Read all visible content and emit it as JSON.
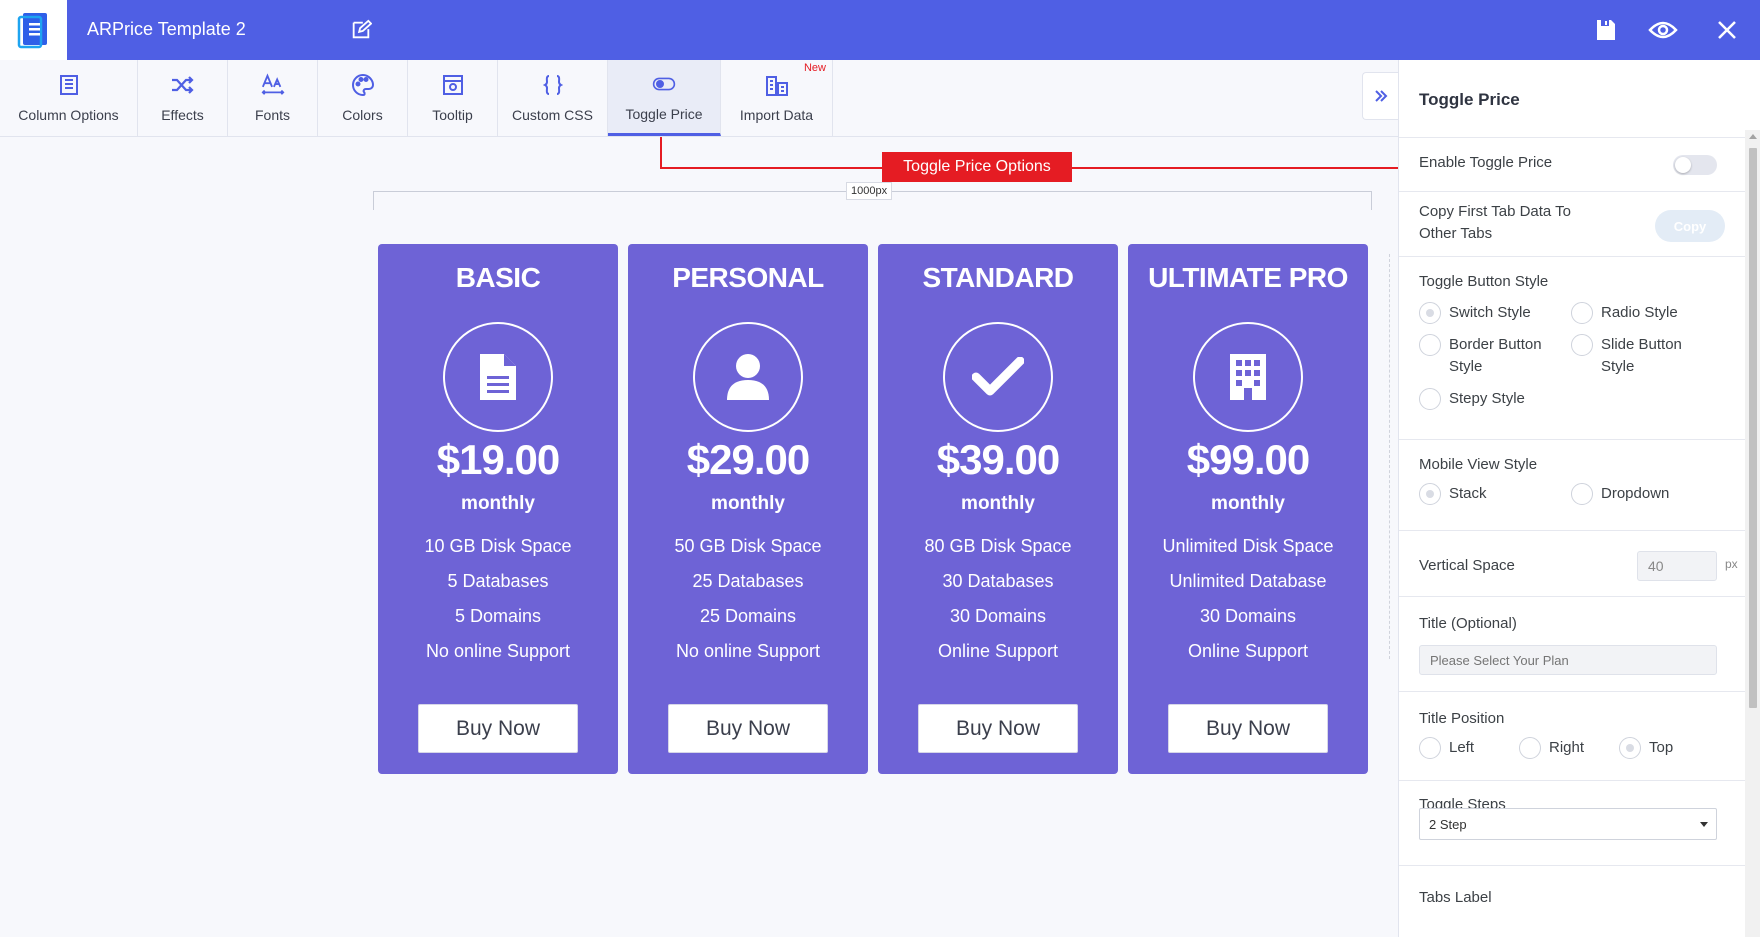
{
  "app": {
    "title": "ARPrice Template 2"
  },
  "toolbar": {
    "items": [
      {
        "label": "Column Options",
        "icon": "columns-icon"
      },
      {
        "label": "Effects",
        "icon": "shuffle-icon"
      },
      {
        "label": "Fonts",
        "icon": "font-size-icon"
      },
      {
        "label": "Colors",
        "icon": "palette-icon"
      },
      {
        "label": "Tooltip",
        "icon": "tooltip-icon"
      },
      {
        "label": "Custom CSS",
        "icon": "braces-icon"
      },
      {
        "label": "Toggle Price",
        "icon": "toggle-icon"
      },
      {
        "label": "Import Data",
        "icon": "import-icon"
      }
    ],
    "active": "Toggle Price",
    "new_badge": "New"
  },
  "canvas": {
    "callout": "Toggle Price Options",
    "ruler_label": "1000px"
  },
  "plans": [
    {
      "title": "BASIC",
      "icon": "file-icon",
      "price": "$19.00",
      "period": "monthly",
      "features": [
        "10 GB Disk Space",
        "5 Databases",
        "5 Domains",
        "No online Support"
      ],
      "button": "Buy Now"
    },
    {
      "title": "PERSONAL",
      "icon": "user-icon",
      "price": "$29.00",
      "period": "monthly",
      "features": [
        "50 GB Disk Space",
        "25 Databases",
        "25 Domains",
        "No online Support"
      ],
      "button": "Buy Now"
    },
    {
      "title": "STANDARD",
      "icon": "check-icon",
      "price": "$39.00",
      "period": "monthly",
      "features": [
        "80 GB Disk Space",
        "30 Databases",
        "30 Domains",
        "Online Support"
      ],
      "button": "Buy Now"
    },
    {
      "title": "ULTIMATE PRO",
      "icon": "building-icon",
      "price": "$99.00",
      "period": "monthly",
      "features": [
        "Unlimited Disk Space",
        "Unlimited Database",
        "30 Domains",
        "Online Support"
      ],
      "button": "Buy Now"
    }
  ],
  "panel": {
    "title": "Toggle Price",
    "enable_toggle": {
      "label": "Enable Toggle Price",
      "on": false
    },
    "copy_tab": {
      "label_line1": "Copy First Tab Data To",
      "label_line2": "Other Tabs",
      "button": "Copy"
    },
    "button_style": {
      "label": "Toggle Button Style",
      "options": [
        {
          "line1": "Switch Style",
          "line2": "",
          "selected": true
        },
        {
          "line1": "Radio Style",
          "line2": "",
          "selected": false
        },
        {
          "line1": "Border Button",
          "line2": "Style",
          "selected": false
        },
        {
          "line1": "Slide Button",
          "line2": "Style",
          "selected": false
        },
        {
          "line1": "Stepy Style",
          "line2": "",
          "selected": false
        }
      ]
    },
    "mobile_view": {
      "label": "Mobile View Style",
      "options": [
        {
          "line1": "Stack",
          "selected": true
        },
        {
          "line1": "Dropdown",
          "selected": false
        }
      ]
    },
    "vertical_space": {
      "label": "Vertical Space",
      "value": "40",
      "unit": "px"
    },
    "title_optional": {
      "label": "Title (Optional)",
      "placeholder": "Please Select Your Plan"
    },
    "title_position": {
      "label": "Title Position",
      "options": [
        {
          "line1": "Left",
          "selected": false
        },
        {
          "line1": "Right",
          "selected": false
        },
        {
          "line1": "Top",
          "selected": true
        }
      ]
    },
    "toggle_steps": {
      "label": "Toggle Steps",
      "value": "2 Step"
    },
    "tabs_label": {
      "label": "Tabs Label"
    }
  },
  "colors": {
    "brand": "#4f5fe4",
    "card": "#6e63d6",
    "callout": "#e51c23"
  }
}
